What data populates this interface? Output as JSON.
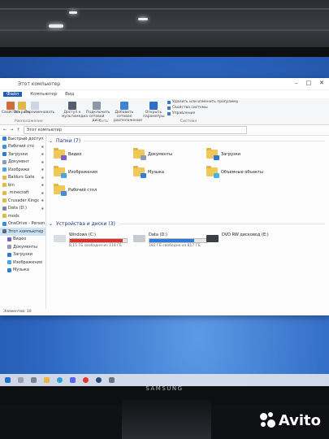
{
  "window": {
    "title": "Этот компьютер",
    "tabs": [
      "Файл",
      "Компьютер",
      "Вид"
    ],
    "active_tab": "Компьютер",
    "ribbon": {
      "buttons": [
        "Свойства",
        "Открыть",
        "Переименовать",
        "Доступ к мультимедиа",
        "Подключить сетевой диск",
        "Добавить сетевое расположение",
        "Открыть параметры"
      ],
      "system_items": [
        "Удалить или изменить программу",
        "Свойства системы",
        "Управление"
      ],
      "groups": [
        "Расположение",
        "Сеть",
        "Система"
      ]
    },
    "address": "Этот компьютер",
    "nav": [
      {
        "label": "Быстрый доступ",
        "pinned": false
      },
      {
        "label": "Рабочий сто",
        "pinned": true
      },
      {
        "label": "Загрузки",
        "pinned": true
      },
      {
        "label": "Документ",
        "pinned": true
      },
      {
        "label": "Изображе",
        "pinned": true
      },
      {
        "label": "Baldurs Gate",
        "pinned": true
      },
      {
        "label": "bin",
        "pinned": true
      },
      {
        "label": ".minecraft",
        "pinned": true
      },
      {
        "label": "Crusader Kings",
        "pinned": true
      },
      {
        "label": "Data (D:)",
        "pinned": true
      },
      {
        "label": "mods",
        "pinned": false
      },
      {
        "label": "OneDrive - Person",
        "pinned": false
      },
      {
        "label": "Этот компьютер",
        "pinned": false,
        "selected": true
      },
      {
        "label": "Видео",
        "pinned": false
      },
      {
        "label": "Документы",
        "pinned": false
      },
      {
        "label": "Загрузки",
        "pinned": false
      },
      {
        "label": "Изображения",
        "pinned": false
      },
      {
        "label": "Музыка",
        "pinned": false
      }
    ],
    "folders_header": "Папки (7)",
    "folders": [
      {
        "label": "Видео",
        "badge_color": "#7a5ed1"
      },
      {
        "label": "Документы",
        "badge_color": "#8d9bb0"
      },
      {
        "label": "Загрузки",
        "badge_color": "#2b7ad6"
      },
      {
        "label": "Изображения",
        "badge_color": "#4aa3e6"
      },
      {
        "label": "Музыка",
        "badge_color": "#2f7fd8"
      },
      {
        "label": "Объемные объекты",
        "badge_color": "#41b6e6"
      },
      {
        "label": "Рабочий стол",
        "badge_color": "#3d8de0"
      }
    ],
    "drives_header": "Устройства и диски (3)",
    "drives": [
      {
        "label": "Windows (C:)",
        "free": "8,15 ГБ свободно из 118 ГБ",
        "fill": 0.93,
        "color": "#d9322b"
      },
      {
        "label": "Data (D:)",
        "free": "182 ГБ свободно из 817 ГБ",
        "fill": 0.78,
        "color": "#2f7ad8"
      },
      {
        "label": "DVD RW дисковод (E:)",
        "free": "",
        "fill": null,
        "color": "#2f7ad8"
      }
    ],
    "status": "Элементов: 10"
  },
  "monitor": {
    "brand": "SAMSUNG"
  },
  "watermark": {
    "text": "Avito"
  }
}
